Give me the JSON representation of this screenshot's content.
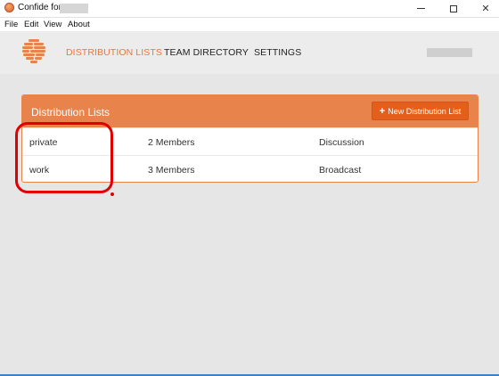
{
  "window": {
    "title": "Confide for",
    "controls": {
      "minimize": "minimize",
      "maximize": "maximize",
      "close": "✕"
    }
  },
  "menu": [
    "File",
    "Edit",
    "View",
    "About"
  ],
  "nav": {
    "distribution_lists": "DISTRIBUTION LISTS",
    "team_directory": "TEAM DIRECTORY",
    "settings": "SETTINGS"
  },
  "panel": {
    "title": "Distribution Lists",
    "new_button": "New Distribution List",
    "new_button_icon": "+",
    "rows": [
      {
        "name": "private",
        "members": "2 Members",
        "type": "Discussion"
      },
      {
        "name": "work",
        "members": "3 Members",
        "type": "Broadcast"
      }
    ]
  },
  "colors": {
    "accent": "#e8834c",
    "button": "#e45f1c",
    "nav_active": "#e8783e",
    "annotation": "#e00000"
  }
}
